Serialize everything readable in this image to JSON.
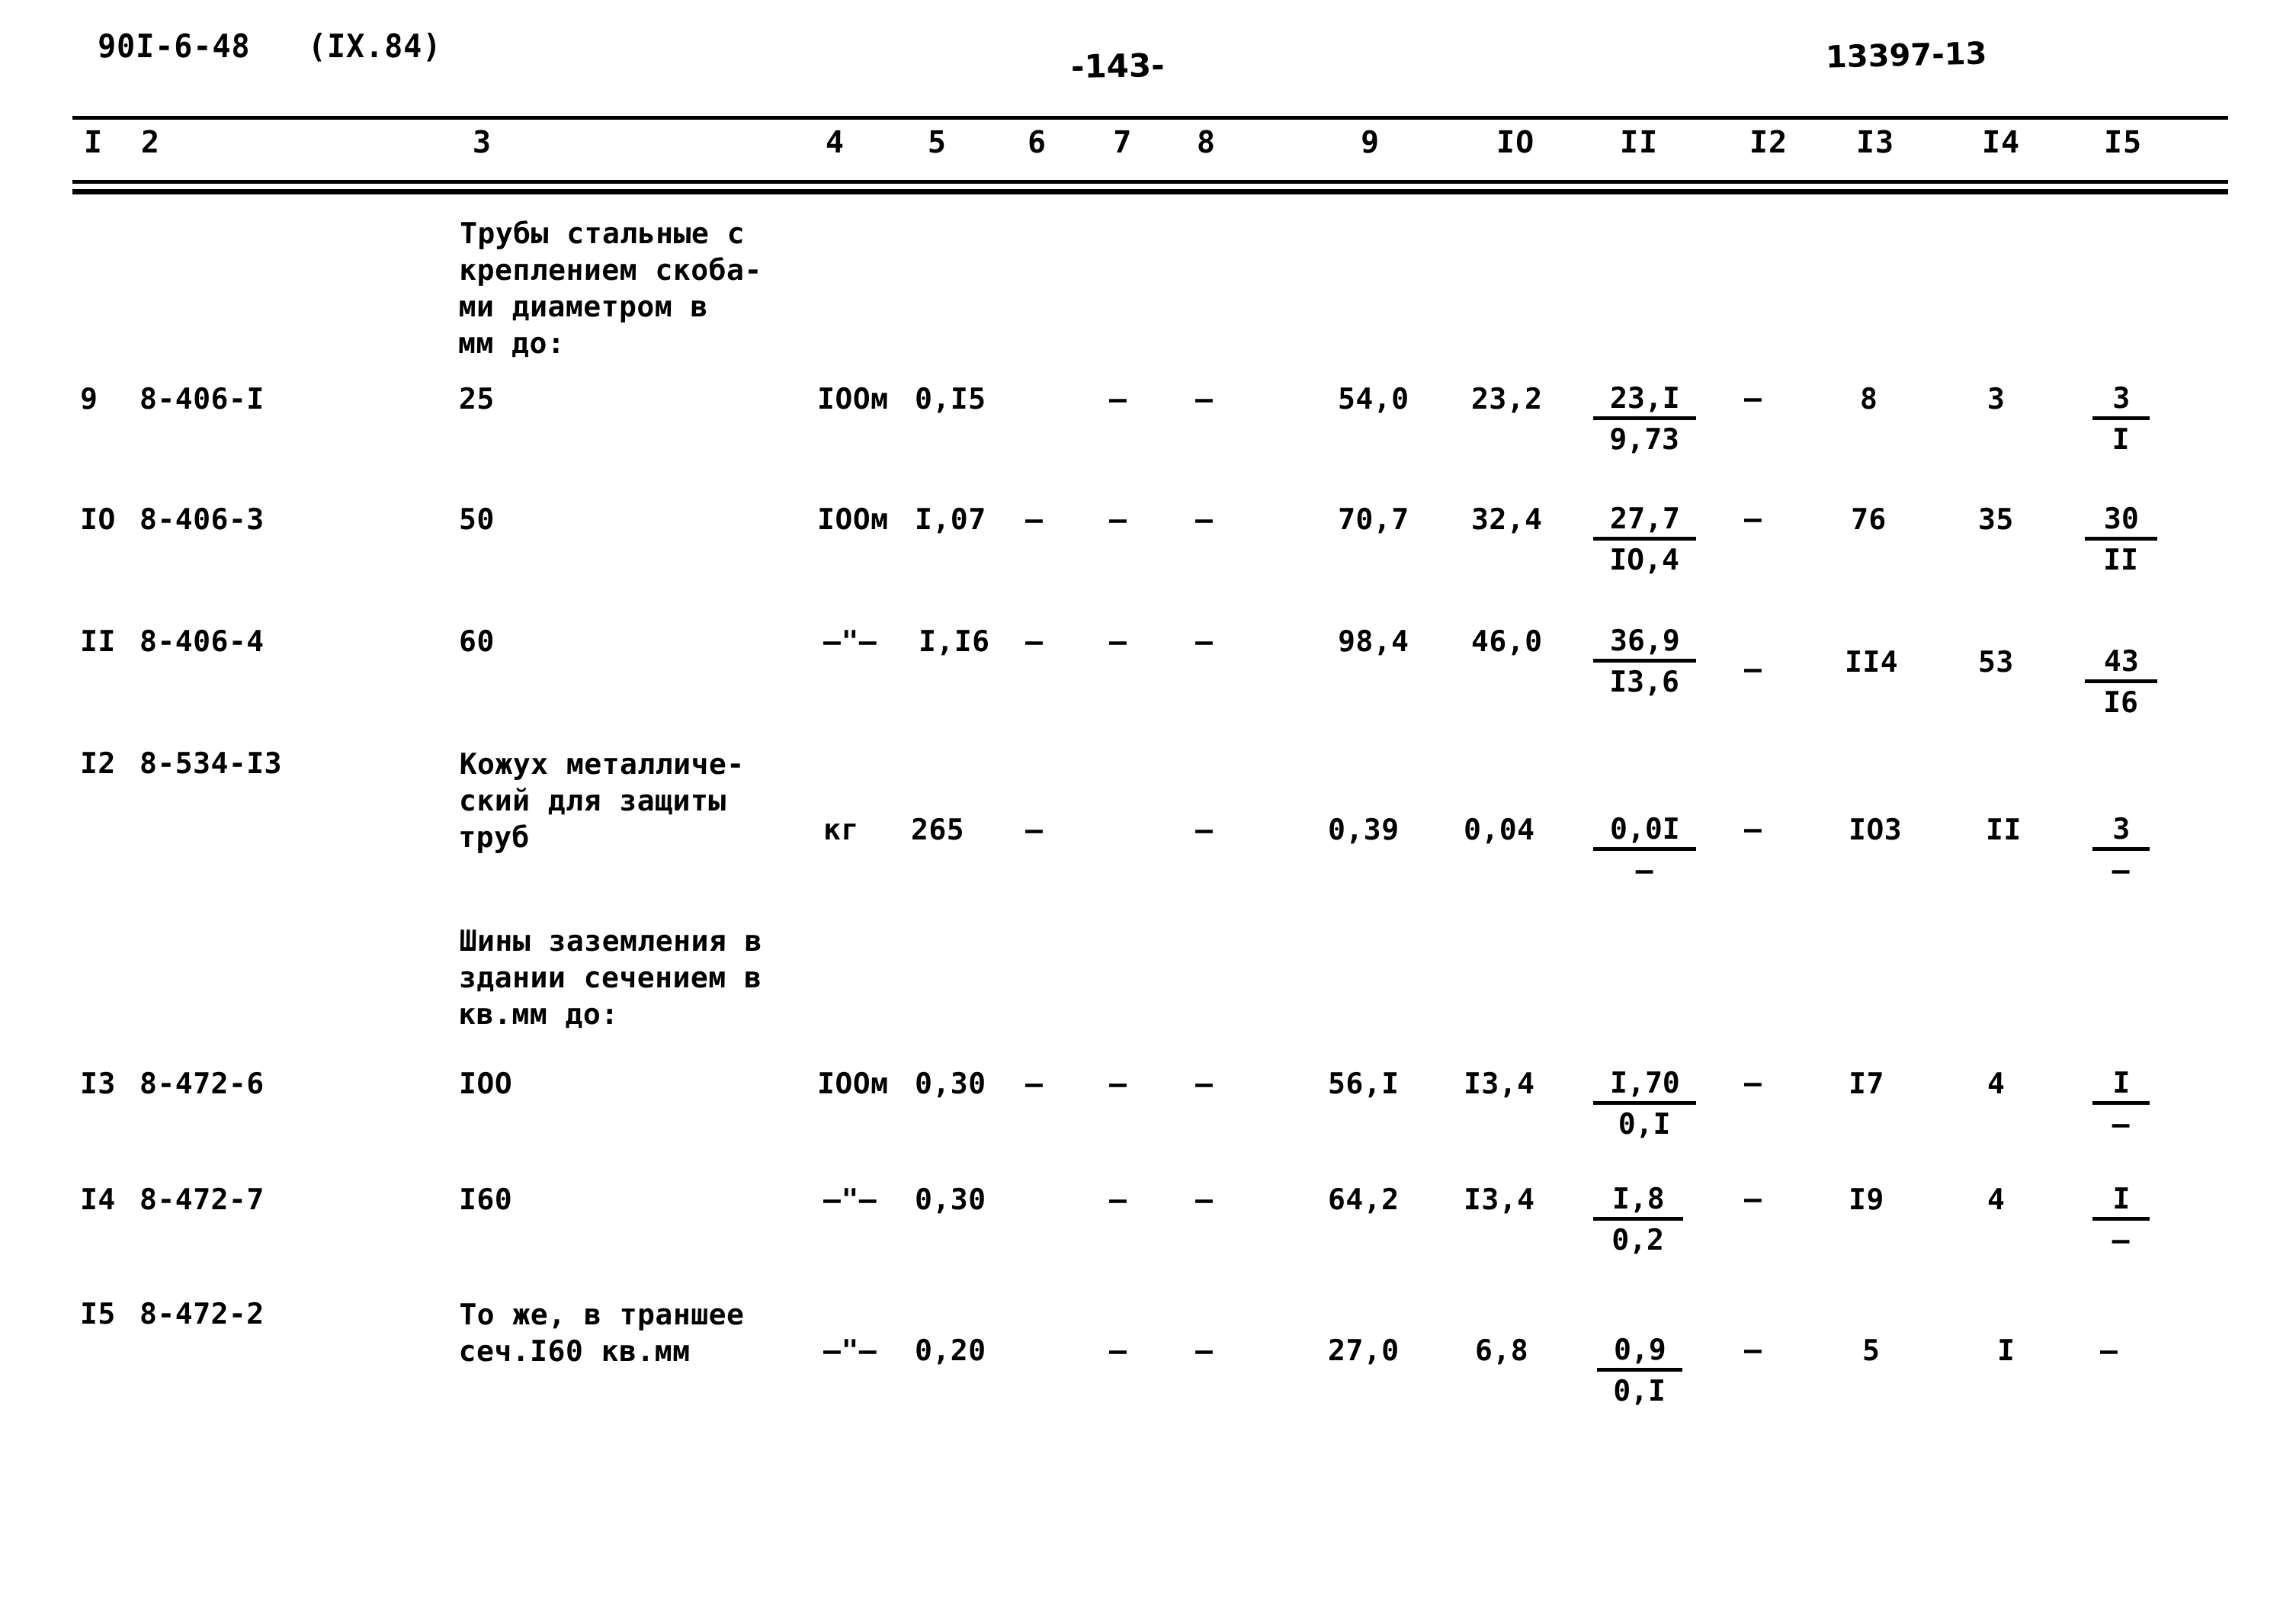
{
  "header": {
    "doc_code": "90I-6-48   (IX.84)",
    "page_number": "-143-",
    "archive_code": "13397-13"
  },
  "table": {
    "column_headers": [
      "I",
      "2",
      "3",
      "4",
      "5",
      "6",
      "7",
      "8",
      "9",
      "IO",
      "II",
      "I2",
      "I3",
      "I4",
      "I5"
    ],
    "group_heading_1": "Трубы стальные с\nкреплением скоба-\nми диаметром в\nмм до:",
    "group_heading_2": "Шины заземления в\nздании сечением в\nкв.мм до:",
    "rows": [
      {
        "num": "9",
        "code": "8-406-I",
        "name": "25",
        "unit": "IOOм",
        "c5": "0,I5",
        "c6": "",
        "c7": "–",
        "c8": "–",
        "c9": "54,0",
        "c10": "23,2",
        "c11_num": "23,I",
        "c11_den": "9,73",
        "c12": "–",
        "c13": "8",
        "c14": "3",
        "c15_num": "3",
        "c15_den": "I"
      },
      {
        "num": "IO",
        "code": "8-406-3",
        "name": "50",
        "unit": "IOOм",
        "c5": "I,07",
        "c6": "–",
        "c7": "–",
        "c8": "–",
        "c9": "70,7",
        "c10": "32,4",
        "c11_num": "27,7",
        "c11_den": "IO,4",
        "c12": "–",
        "c13": "76",
        "c14": "35",
        "c15_num": "30",
        "c15_den": "II"
      },
      {
        "num": "II",
        "code": "8-406-4",
        "name": "60",
        "unit": "–\"–",
        "c5": "I,I6",
        "c6": "–",
        "c7": "–",
        "c8": "–",
        "c9": "98,4",
        "c10": "46,0",
        "c11_num": "36,9",
        "c11_den": "I3,6",
        "c12": "–",
        "c13": "II4",
        "c14": "53",
        "c15_num": "43",
        "c15_den": "I6"
      },
      {
        "num": "I2",
        "code": "8-534-I3",
        "name": "Кожух металличе-\nский для защиты\nтруб",
        "unit": "кг",
        "c5": "265",
        "c6": "–",
        "c7": "",
        "c8": "–",
        "c9": "0,39",
        "c10": "0,04",
        "c11_num": "0,0I",
        "c11_den": "–",
        "c12": "–",
        "c13": "IO3",
        "c14": "II",
        "c15_num": "3",
        "c15_den": "–"
      },
      {
        "num": "I3",
        "code": "8-472-6",
        "name": "IOO",
        "unit": "IOOм",
        "c5": "0,30",
        "c6": "–",
        "c7": "–",
        "c8": "–",
        "c9": "56,I",
        "c10": "I3,4",
        "c11_num": "I,70",
        "c11_den": "0,I",
        "c12": "–",
        "c13": "I7",
        "c14": "4",
        "c15_num": "I",
        "c15_den": "–"
      },
      {
        "num": "I4",
        "code": "8-472-7",
        "name": "I60",
        "unit": "–\"–",
        "c5": "0,30",
        "c6": "",
        "c7": "–",
        "c8": "–",
        "c9": "64,2",
        "c10": "I3,4",
        "c11_num": "I,8",
        "c11_den": "0,2",
        "c12": "–",
        "c13": "I9",
        "c14": "4",
        "c15_num": "I",
        "c15_den": "–"
      },
      {
        "num": "I5",
        "code": "8-472-2",
        "name": "То же, в траншее\nсеч.I60 кв.мм",
        "unit": "–\"–",
        "c5": "0,20",
        "c6": "",
        "c7": "–",
        "c8": "–",
        "c9": "27,0",
        "c10": "6,8",
        "c11_num": "0,9",
        "c11_den": "0,I",
        "c12": "–",
        "c13": "5",
        "c14": "I",
        "c15_num": "–",
        "c15_den": ""
      }
    ]
  }
}
